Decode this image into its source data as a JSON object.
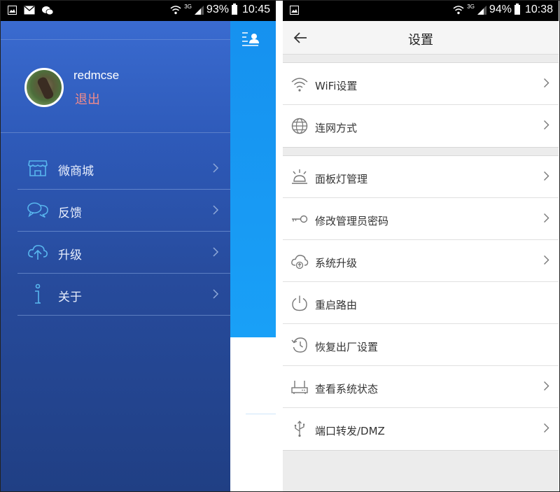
{
  "left_screen": {
    "statusbar": {
      "signal_gen": "3G",
      "battery": "93%",
      "time": "10:45"
    },
    "profile": {
      "username": "redmcse",
      "logout_label": "退出"
    },
    "menu": [
      {
        "label": "微商城",
        "icon": "store-icon"
      },
      {
        "label": "反馈",
        "icon": "chat-bubbles-icon"
      },
      {
        "label": "升级",
        "icon": "cloud-upload-icon"
      },
      {
        "label": "关于",
        "icon": "info-icon"
      }
    ]
  },
  "right_screen": {
    "statusbar": {
      "signal_gen": "3G",
      "battery": "94%",
      "time": "10:38"
    },
    "title": "设置",
    "groups": [
      [
        {
          "label": "WiFi设置",
          "icon": "wifi-icon",
          "arrow": true
        },
        {
          "label": "连网方式",
          "icon": "globe-icon",
          "arrow": true
        }
      ],
      [
        {
          "label": "面板灯管理",
          "icon": "lamp-icon",
          "arrow": true
        },
        {
          "label": "修改管理员密码",
          "icon": "key-icon",
          "arrow": true
        },
        {
          "label": "系统升级",
          "icon": "cloud-upgrade-icon",
          "arrow": true
        },
        {
          "label": "重启路由",
          "icon": "power-icon",
          "arrow": false
        },
        {
          "label": "恢复出厂设置",
          "icon": "restore-icon",
          "arrow": false
        },
        {
          "label": "查看系统状态",
          "icon": "router-icon",
          "arrow": true
        },
        {
          "label": "端口转发/DMZ",
          "icon": "usb-icon",
          "arrow": true
        }
      ]
    ]
  },
  "colors": {
    "drawer_top": "#3a6bd0",
    "drawer_bottom": "#203f84",
    "logout": "#f08b8b",
    "behind_blue": "#1691ef",
    "settings_bg": "#ececec"
  }
}
